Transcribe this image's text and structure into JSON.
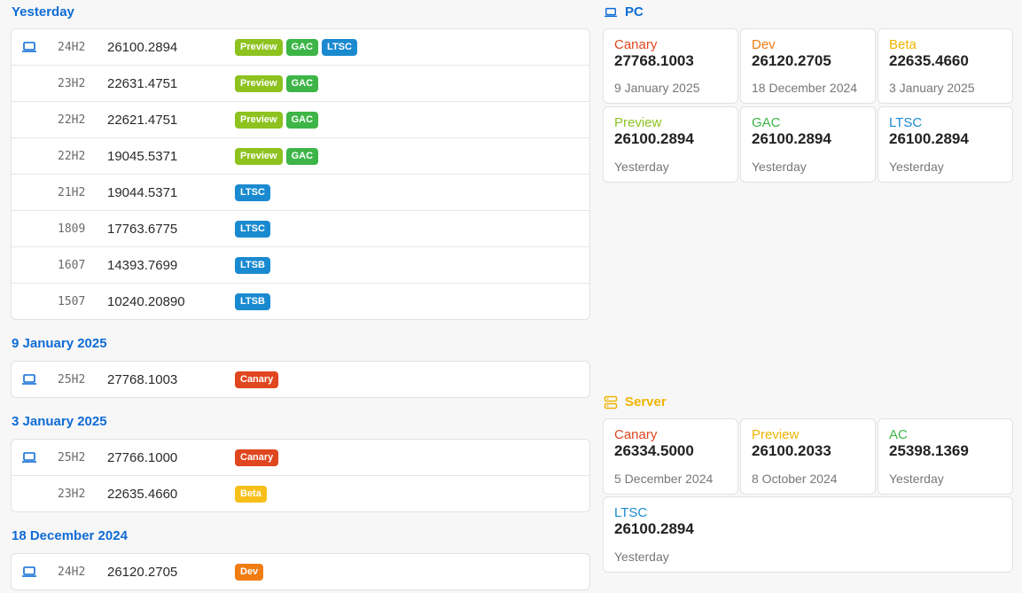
{
  "feed": {
    "groups": [
      {
        "date": "Yesterday",
        "rows": [
          {
            "version": "24H2",
            "build": "26100.2894",
            "badges": [
              "Preview",
              "GAC",
              "LTSC"
            ]
          },
          {
            "version": "23H2",
            "build": "22631.4751",
            "badges": [
              "Preview",
              "GAC"
            ]
          },
          {
            "version": "22H2",
            "build": "22621.4751",
            "badges": [
              "Preview",
              "GAC"
            ]
          },
          {
            "version": "22H2",
            "build": "19045.5371",
            "badges": [
              "Preview",
              "GAC"
            ]
          },
          {
            "version": "21H2",
            "build": "19044.5371",
            "badges": [
              "LTSC"
            ]
          },
          {
            "version": "1809",
            "build": "17763.6775",
            "badges": [
              "LTSC"
            ]
          },
          {
            "version": "1607",
            "build": "14393.7699",
            "badges": [
              "LTSB"
            ]
          },
          {
            "version": "1507",
            "build": "10240.20890",
            "badges": [
              "LTSB"
            ]
          }
        ]
      },
      {
        "date": "9 January 2025",
        "rows": [
          {
            "version": "25H2",
            "build": "27768.1003",
            "badges": [
              "Canary"
            ]
          }
        ]
      },
      {
        "date": "3 January 2025",
        "rows": [
          {
            "version": "25H2",
            "build": "27766.1000",
            "badges": [
              "Canary"
            ]
          },
          {
            "version": "23H2",
            "build": "22635.4660",
            "badges": [
              "Beta"
            ]
          }
        ]
      },
      {
        "date": "18 December 2024",
        "rows": [
          {
            "version": "24H2",
            "build": "26120.2705",
            "badges": [
              "Dev"
            ]
          }
        ]
      }
    ]
  },
  "pc": {
    "title": "PC",
    "icon": "laptop-icon",
    "tiles": [
      {
        "channel": "Canary",
        "build": "27768.1003",
        "date": "9 January 2025"
      },
      {
        "channel": "Dev",
        "build": "26120.2705",
        "date": "18 December 2024"
      },
      {
        "channel": "Beta",
        "build": "22635.4660",
        "date": "3 January 2025"
      },
      {
        "channel": "Preview",
        "build": "26100.2894",
        "date": "Yesterday"
      },
      {
        "channel": "GAC",
        "build": "26100.2894",
        "date": "Yesterday"
      },
      {
        "channel": "LTSC",
        "build": "26100.2894",
        "date": "Yesterday"
      }
    ]
  },
  "server": {
    "title": "Server",
    "icon": "server-icon",
    "tiles": [
      {
        "channel": "Canary",
        "build": "26334.5000",
        "date": "5 December 2024"
      },
      {
        "channel": "Preview",
        "build": "26100.2033",
        "date": "8 October 2024"
      },
      {
        "channel": "AC",
        "build": "25398.1369",
        "date": "Yesterday"
      },
      {
        "channel": "LTSC",
        "build": "26100.2894",
        "date": "Yesterday"
      }
    ]
  },
  "colors": {
    "accent": "#0f6cd5",
    "server": "#f0b400",
    "preview": "#8dc21f",
    "gac": "#3db547",
    "ltsc": "#1a8ad0",
    "canary": "#e0461f",
    "beta": "#f7bf18",
    "dev": "#f07c12"
  }
}
